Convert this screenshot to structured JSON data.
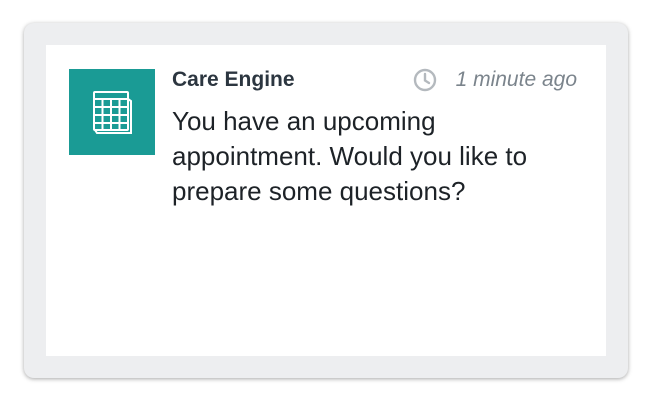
{
  "notification": {
    "app_name": "Care Engine",
    "timestamp": "1 minute ago",
    "message": "You have an upcoming appointment. Would you like to prepare some questions?",
    "app_icon": "calendar-icon",
    "time_icon": "clock-icon"
  },
  "colors": {
    "accent": "#1a9b95",
    "frame": "#edeef0",
    "title": "#2c3640",
    "muted": "#7b848c"
  }
}
